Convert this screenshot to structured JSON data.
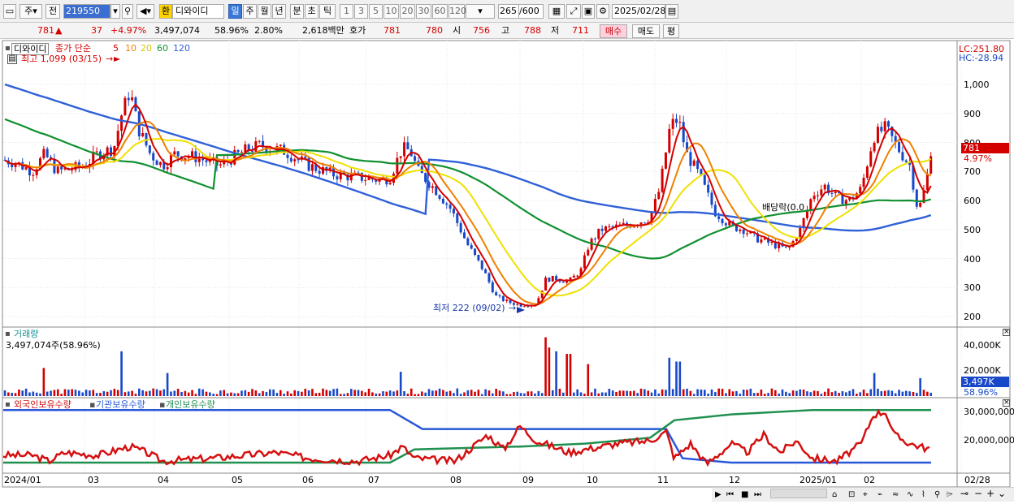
{
  "toolbar": {
    "period_type": "주",
    "prev_label": "전",
    "code": "219550",
    "currency_badge": "환",
    "stock_name": "디와이디",
    "intervals": [
      "일",
      "주",
      "월",
      "년",
      "분",
      "초",
      "틱"
    ],
    "active_interval": "일",
    "minutes": [
      "1",
      "3",
      "5",
      "10",
      "20",
      "30",
      "60",
      "120"
    ],
    "count_value": "265",
    "count_total": "/600",
    "date_value": "2025/02/28"
  },
  "quote": {
    "price": "781",
    "change_arrow": "▲",
    "change": "37",
    "change_pct": "+4.97%",
    "volume": "3,497,074",
    "volume_ratio": "58.96%",
    "turnover_rate": "2.80%",
    "trade_value": "2,618백만",
    "quote_label": "호가",
    "ask": "781",
    "bid": "780",
    "open_label": "시",
    "open": "756",
    "high_label": "고",
    "high": "788",
    "low_label": "저",
    "low": "711",
    "buy_label": "매수",
    "sell_label": "매도",
    "avg_label": "평"
  },
  "price_panel": {
    "title": "디와이디",
    "ma_label": "종가 단순",
    "ma_periods": [
      "5",
      "10",
      "20",
      "60",
      "120"
    ],
    "high_note": "최고 1,099 (03/15)",
    "low_note": "최저 222 (09/02)",
    "dividend_note": "배당락(0.0",
    "lc": "LC:251.80",
    "hc": "HC:-28.94",
    "current_tag": "781",
    "current_pct": "4.97%",
    "y_ticks": [
      "1,000",
      "900",
      "800",
      "700",
      "600",
      "500",
      "400",
      "300",
      "200"
    ]
  },
  "volume_panel": {
    "title": "거래량",
    "value_text": "3,497,074주(58.96%)",
    "y_ticks": [
      "40,000K",
      "20,000K"
    ],
    "current_tag": "3,497K",
    "current_pct": "58.96%"
  },
  "holding_panel": {
    "legend": [
      "외국인보유수량",
      "기관보유수량",
      "개인보유수량"
    ],
    "y_ticks": [
      "30,000,000",
      "20,000,000"
    ]
  },
  "x_axis": [
    "2024/01",
    "03",
    "04",
    "05",
    "06",
    "07",
    "08",
    "09",
    "10",
    "11",
    "12",
    "2025/01",
    "02",
    "02/28"
  ],
  "colors": {
    "ma5": "#d40000",
    "ma10": "#f08000",
    "ma20": "#f0e000",
    "ma60": "#109030",
    "ma120": "#3060d8",
    "up": "#d40000",
    "down": "#1848c8",
    "foreign": "#d41010",
    "inst": "#2858d8",
    "indiv": "#209050"
  },
  "chart_data": {
    "type": "line",
    "title": "디와이디",
    "x": [
      "2024/01",
      "03",
      "04",
      "05",
      "06",
      "07",
      "08",
      "09",
      "10",
      "11",
      "12",
      "2025/01",
      "02"
    ],
    "series": [
      {
        "name": "종가",
        "values": [
          720,
          800,
          760,
          740,
          760,
          690,
          420,
          240,
          510,
          760,
          480,
          470,
          781
        ]
      },
      {
        "name": "5",
        "values": [
          720,
          830,
          760,
          740,
          750,
          690,
          430,
          250,
          500,
          800,
          490,
          470,
          760
        ]
      },
      {
        "name": "120",
        "values": [
          980,
          900,
          860,
          820,
          790,
          760,
          720,
          650,
          560,
          530,
          510,
          490,
          550
        ]
      }
    ],
    "ylim": [
      200,
      1000
    ],
    "volume_note": "3,497,074주(58.96%)"
  }
}
